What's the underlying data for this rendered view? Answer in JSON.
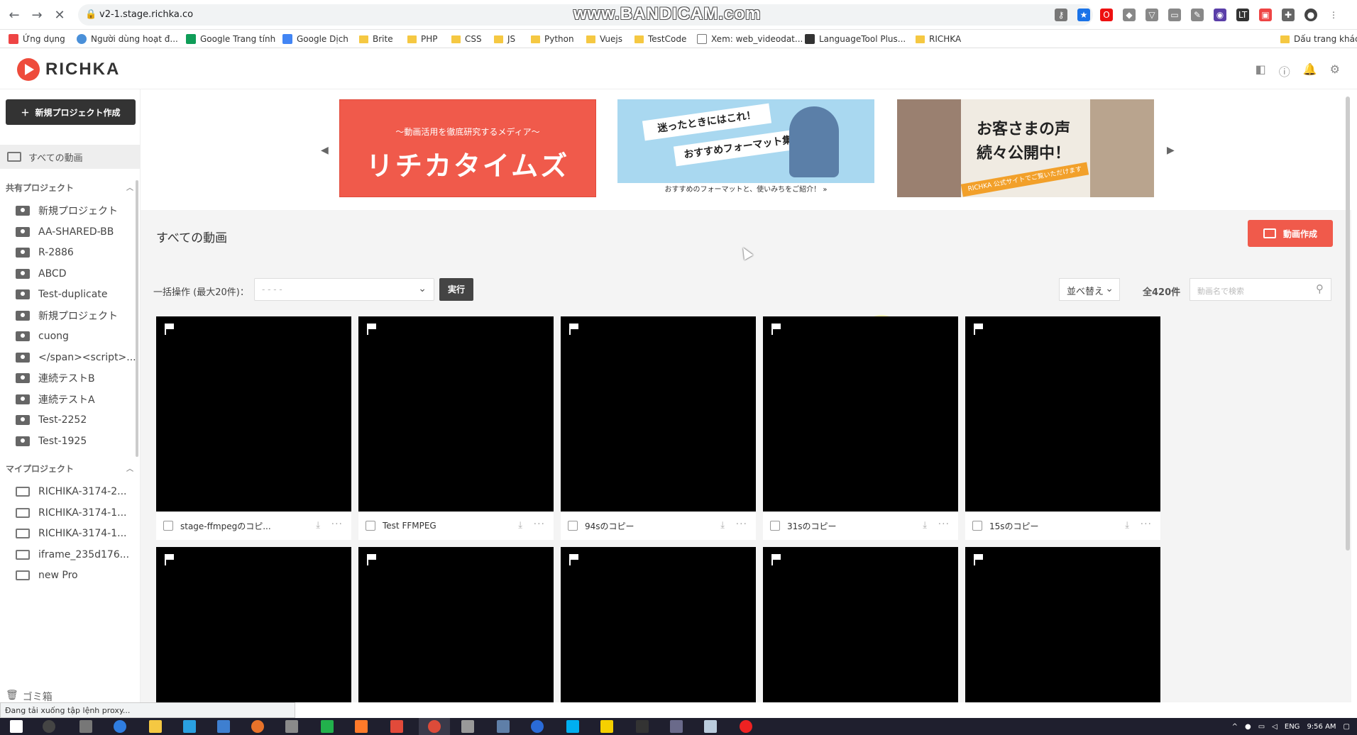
{
  "browser": {
    "url": "v2-1.stage.richka.co",
    "watermark": "www.BANDICAM.com"
  },
  "bookmarks": [
    {
      "label": "Ứng dụng",
      "icon": "apps-grid-icon"
    },
    {
      "label": "Người dùng hoạt đ...",
      "icon": "globe-icon"
    },
    {
      "label": "Google Trang tính",
      "icon": "sheets-icon"
    },
    {
      "label": "Google Dịch",
      "icon": "translate-icon"
    },
    {
      "label": "Brite",
      "icon": "folder-icon"
    },
    {
      "label": "PHP",
      "icon": "folder-icon"
    },
    {
      "label": "CSS",
      "icon": "folder-icon"
    },
    {
      "label": "JS",
      "icon": "folder-icon"
    },
    {
      "label": "Python",
      "icon": "folder-icon"
    },
    {
      "label": "Vuejs",
      "icon": "folder-icon"
    },
    {
      "label": "TestCode",
      "icon": "folder-icon"
    },
    {
      "label": "Xem: web_videodat...",
      "icon": "link-icon"
    },
    {
      "label": "LanguageTool Plus...",
      "icon": "languagetool-icon"
    },
    {
      "label": "RICHKA",
      "icon": "folder-icon"
    }
  ],
  "bookmarks_other": "Dấu trang khác",
  "app": {
    "brand": "RICHKA"
  },
  "sidebar": {
    "new_project_button": "新規プロジェクト作成",
    "all_videos": "すべての動画",
    "shared_title": "共有プロジェクト",
    "shared_projects": [
      "新規プロジェクト",
      "AA-SHARED-BB",
      "R-2886",
      "ABCD",
      "Test-duplicate",
      "新規プロジェクト",
      "cuong",
      "</span><script>...",
      "連続テストB",
      "連続テストA",
      "Test-2252",
      "Test-1925"
    ],
    "my_title": "マイプロジェクト",
    "my_projects": [
      "RICHIKA-3174-2...",
      "RICHIKA-3174-1...",
      "RICHIKA-3174-1...",
      "iframe_235d176...",
      "new Pro"
    ],
    "trash": "ゴミ箱"
  },
  "banners": [
    {
      "subtitle": "〜動画活用を徹底研究するメディア〜",
      "title": "リチカタイムズ"
    },
    {
      "line1": "迷ったときにはこれ！",
      "line2": "おすすめフォーマット集",
      "footer": "おすすめのフォーマットと、使いみちをご紹介！ »"
    },
    {
      "line1": "お客さまの声",
      "line2": "続々公開中！",
      "ribbon": "RICHKA 公式サイトでご覧いただけます"
    }
  ],
  "main": {
    "page_title": "すべての動画",
    "create_button": "動画作成",
    "bulk_label": "一括操作 (最大20件)：",
    "bulk_placeholder": "- - - -",
    "exec_button": "実行",
    "sort_label": "並べ替え",
    "total": "全420件",
    "search_placeholder": "動画名で検索"
  },
  "videos": [
    {
      "title": "stage-ffmpegのコピ..."
    },
    {
      "title": "Test FFMPEG"
    },
    {
      "title": "94sのコピー"
    },
    {
      "title": "31sのコピー"
    },
    {
      "title": "15sのコピー"
    }
  ],
  "statusbar": "Đang tải xuống tập lệnh proxy...",
  "taskbar": {
    "lang": "ENG",
    "time": "9:56 AM"
  },
  "colors": {
    "accent": "#f05a4b",
    "dark_button": "#333333",
    "main_bg": "#f4f4f4"
  }
}
